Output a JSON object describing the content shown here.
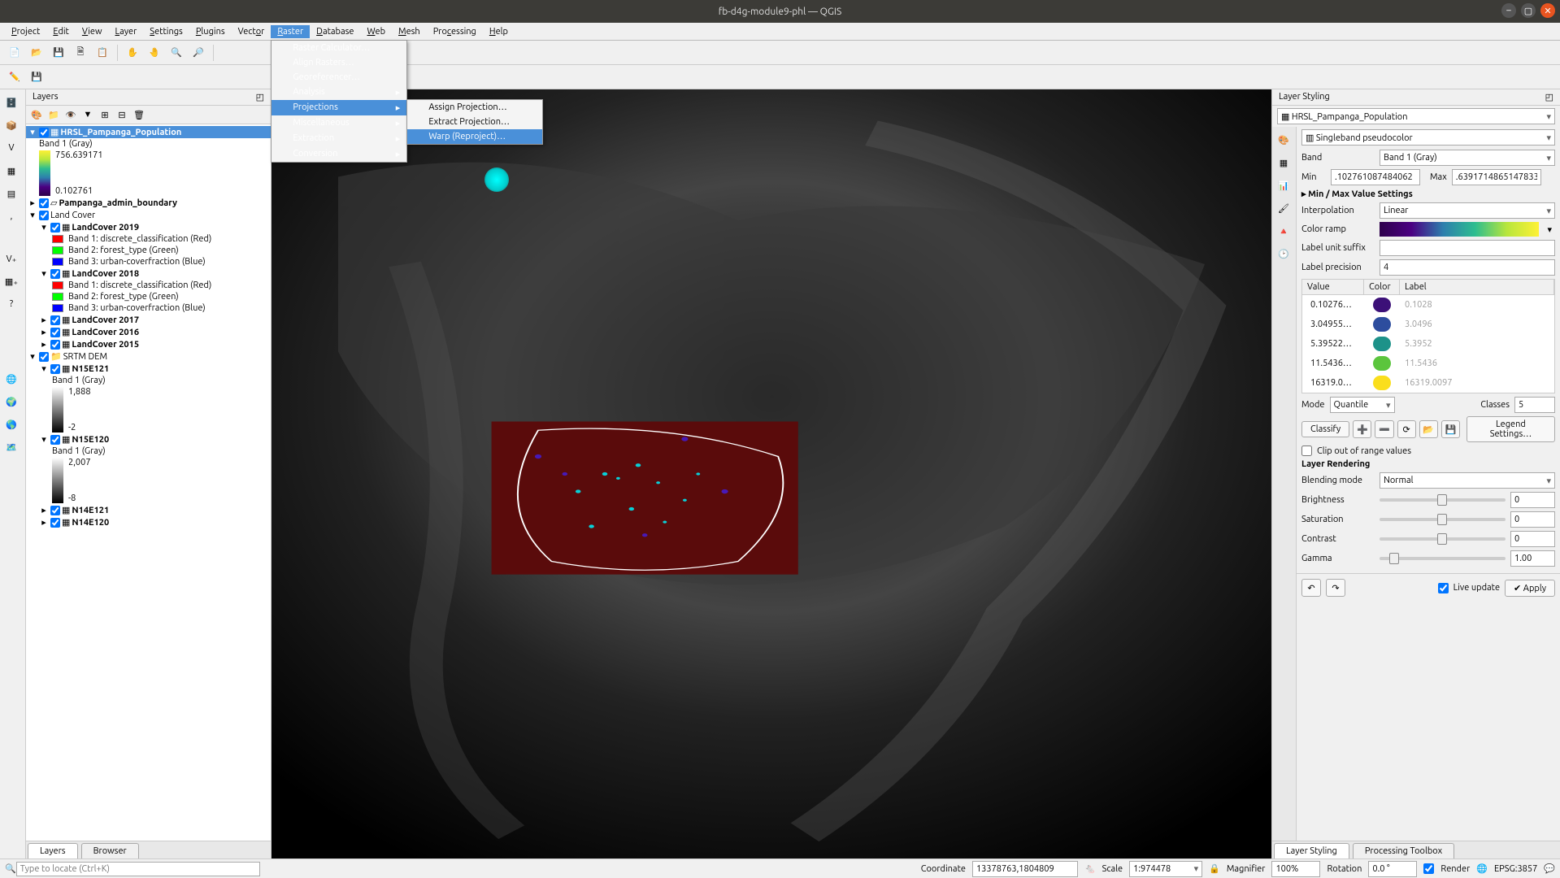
{
  "window": {
    "title": "fb-d4g-module9-phl — QGIS"
  },
  "menubar": [
    "Project",
    "Edit",
    "View",
    "Layer",
    "Settings",
    "Plugins",
    "Vector",
    "Raster",
    "Database",
    "Web",
    "Mesh",
    "Processing",
    "Help"
  ],
  "active_menu": "Raster",
  "raster_menu": [
    {
      "label": "Raster Calculator…",
      "icon": "calculator-icon"
    },
    {
      "label": "Align Rasters…"
    },
    {
      "label": "Georeferencer…",
      "icon": "georeferencer-icon"
    },
    {
      "label": "Analysis",
      "submenu": true
    },
    {
      "label": "Projections",
      "submenu": true,
      "highlight": true
    },
    {
      "label": "Miscellaneous",
      "submenu": true
    },
    {
      "label": "Extraction",
      "submenu": true
    },
    {
      "label": "Conversion",
      "submenu": true
    }
  ],
  "projections_submenu": [
    {
      "label": "Assign Projection…",
      "icon": "assign-icon"
    },
    {
      "label": "Extract Projection…",
      "icon": "extract-icon"
    },
    {
      "label": "Warp (Reproject)…",
      "icon": "warp-icon",
      "highlight": true
    }
  ],
  "layers_panel": {
    "title": "Layers"
  },
  "layers": [
    {
      "name": "HRSL_Pampanga_Population",
      "selected": true,
      "checked": true,
      "band": "Band 1 (Gray)",
      "grad_top": "756.639171",
      "grad_bottom": "0.102761",
      "grad_colors": [
        "#fef135",
        "#b8e63c",
        "#2dbd8f",
        "#2d7fad",
        "#4b0082",
        "#2d004b"
      ]
    },
    {
      "name": "Pampanga_admin_boundary",
      "checked": true,
      "bold": true
    },
    {
      "name": "Land Cover",
      "checked": true,
      "children": [
        {
          "name": "LandCover 2019",
          "checked": true,
          "bands": [
            {
              "color": "#ff0000",
              "label": "Band 1: discrete_classification (Red)"
            },
            {
              "color": "#00ff00",
              "label": "Band 2: forest_type (Green)"
            },
            {
              "color": "#0000ff",
              "label": "Band 3: urban-coverfraction (Blue)"
            }
          ]
        },
        {
          "name": "LandCover 2018",
          "checked": true,
          "bands": [
            {
              "color": "#ff0000",
              "label": "Band 1: discrete_classification (Red)"
            },
            {
              "color": "#00ff00",
              "label": "Band 2: forest_type (Green)"
            },
            {
              "color": "#0000ff",
              "label": "Band 3: urban-coverfraction (Blue)"
            }
          ]
        },
        {
          "name": "LandCover 2017",
          "checked": true
        },
        {
          "name": "LandCover 2016",
          "checked": true
        },
        {
          "name": "LandCover 2015",
          "checked": true
        }
      ]
    },
    {
      "name": "SRTM DEM",
      "checked": true,
      "children": [
        {
          "name": "N15E121",
          "checked": true,
          "band": "Band 1 (Gray)",
          "grad_top": "1,888",
          "grad_bottom": "-2",
          "grad_colors": [
            "#ffffff",
            "#000000"
          ]
        },
        {
          "name": "N15E120",
          "checked": true,
          "band": "Band 1 (Gray)",
          "grad_top": "2,007",
          "grad_bottom": "-8",
          "grad_colors": [
            "#ffffff",
            "#000000"
          ]
        },
        {
          "name": "N14E121",
          "checked": true
        },
        {
          "name": "N14E120",
          "checked": true
        }
      ]
    }
  ],
  "left_tabs": [
    "Layers",
    "Browser"
  ],
  "style": {
    "title": "Layer Styling",
    "layer": "HRSL_Pampanga_Population",
    "renderer": "Singleband pseudocolor",
    "band_label": "Band",
    "band": "Band 1 (Gray)",
    "min_label": "Min",
    "min": ".102761087484062",
    "max_label": "Max",
    "max": ".6391714865147833",
    "minmax_header": "Min / Max Value Settings",
    "interp_label": "Interpolation",
    "interp": "Linear",
    "ramp_label": "Color ramp",
    "suffix_label": "Label unit suffix",
    "suffix": "",
    "precision_label": "Label precision",
    "precision": "4",
    "col_value": "Value",
    "col_color": "Color",
    "col_label": "Label",
    "rows": [
      {
        "value": "0.10276…",
        "color": "#3c1078",
        "label": "0.1028"
      },
      {
        "value": "3.04955…",
        "color": "#2d4d9e",
        "label": "3.0496"
      },
      {
        "value": "5.39522…",
        "color": "#1d9289",
        "label": "5.3952"
      },
      {
        "value": "11.5436…",
        "color": "#5bc53d",
        "label": "11.5436"
      },
      {
        "value": "16319.0…",
        "color": "#fade1c",
        "label": "16319.0097"
      }
    ],
    "mode_label": "Mode",
    "mode": "Quantile",
    "classes_label": "Classes",
    "classes": "5",
    "classify": "Classify",
    "legend_settings": "Legend Settings…",
    "clip": "Clip out of range values",
    "rendering_header": "Layer Rendering",
    "blend_label": "Blending mode",
    "blend": "Normal",
    "brightness_label": "Brightness",
    "brightness": "0",
    "saturation_label": "Saturation",
    "saturation": "0",
    "contrast_label": "Contrast",
    "contrast": "0",
    "gamma_label": "Gamma",
    "gamma": "1.00",
    "live_update": "Live update",
    "apply": "Apply"
  },
  "right_tabs": [
    "Layer Styling",
    "Processing Toolbox"
  ],
  "status": {
    "locator_ph": "Type to locate (Ctrl+K)",
    "coord_label": "Coordinate",
    "coord": "13378763,1804809",
    "scale_label": "Scale",
    "scale": "1:974478",
    "magnifier_label": "Magnifier",
    "magnifier": "100%",
    "rotation_label": "Rotation",
    "rotation": "0.0 °",
    "render": "Render",
    "crs": "EPSG:3857"
  }
}
